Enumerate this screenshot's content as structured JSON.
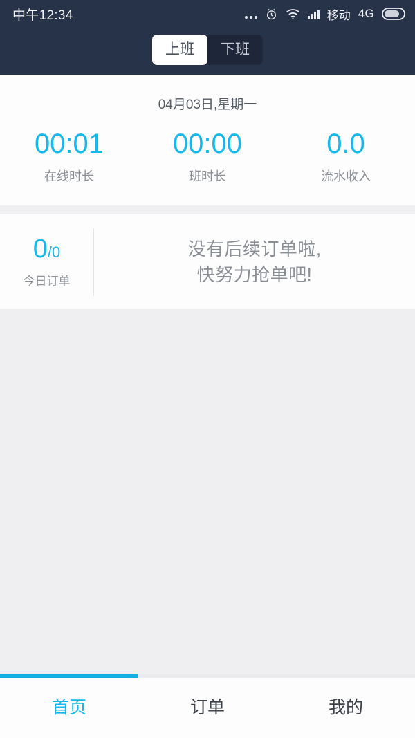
{
  "statusbar": {
    "time": "中午12:34",
    "more_icon": "more-dots-icon",
    "alarm_icon": "alarm-clock-icon",
    "wifi_icon": "wifi-icon",
    "signal_icon": "signal-bars-icon",
    "carrier": "移动",
    "network": "4G",
    "battery_icon": "battery-icon"
  },
  "header": {
    "background_color": "#273349",
    "toggle": {
      "on_duty_label": "上班",
      "off_duty_label": "下班",
      "active": "上班"
    }
  },
  "stats": {
    "date": "04月03日,星期一",
    "items": [
      {
        "value": "00:01",
        "label": "在线时长"
      },
      {
        "value": "00:00",
        "label": "班时长"
      },
      {
        "value": "0.0",
        "label": "流水收入"
      }
    ]
  },
  "orders": {
    "count_main": "0",
    "count_sub": "/0",
    "count_label": "今日订单",
    "empty_line1": "没有后续订单啦,",
    "empty_line2": "快努力抢单吧!"
  },
  "tabbar": {
    "items": [
      {
        "label": "首页",
        "active": true
      },
      {
        "label": "订单",
        "active": false
      },
      {
        "label": "我的",
        "active": false
      }
    ]
  },
  "colors": {
    "accent": "#16b7ec",
    "header": "#273349",
    "body": "#efeff1",
    "card": "#fdfdfd",
    "muted_text": "#8d9299"
  }
}
